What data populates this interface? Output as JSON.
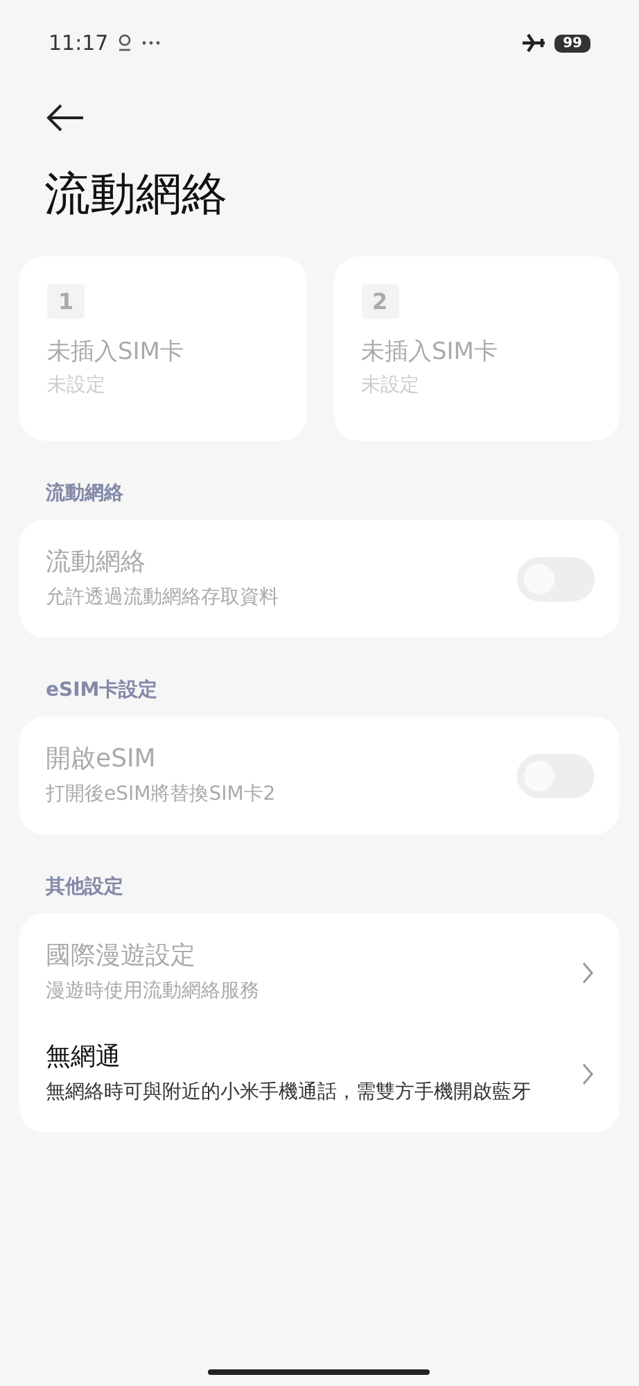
{
  "status_bar": {
    "time": "11:17",
    "battery": "99"
  },
  "title": "流動網絡",
  "sim_cards": [
    {
      "number": "1",
      "title": "未插入SIM卡",
      "subtitle": "未設定",
      "disabled": true
    },
    {
      "number": "2",
      "title": "未插入SIM卡",
      "subtitle": "未設定",
      "disabled": true
    }
  ],
  "sections": [
    {
      "header": "流動網絡",
      "rows": [
        {
          "kind": "toggle",
          "title": "流動網絡",
          "subtitle": "允許透過流動網絡存取資料",
          "disabled": true,
          "on": false
        }
      ]
    },
    {
      "header": "eSIM卡設定",
      "rows": [
        {
          "kind": "toggle",
          "title": "開啟eSIM",
          "subtitle": "打開後eSIM將替換SIM卡2",
          "disabled": true,
          "on": false
        }
      ]
    },
    {
      "header": "其他設定",
      "rows": [
        {
          "kind": "link",
          "title": "國際漫遊設定",
          "subtitle": "漫遊時使用流動網絡服務",
          "disabled": true
        },
        {
          "kind": "link",
          "title": "無網通",
          "subtitle": "無網絡時可與附近的小米手機通話，需雙方手機開啟藍牙",
          "disabled": false
        }
      ]
    }
  ]
}
